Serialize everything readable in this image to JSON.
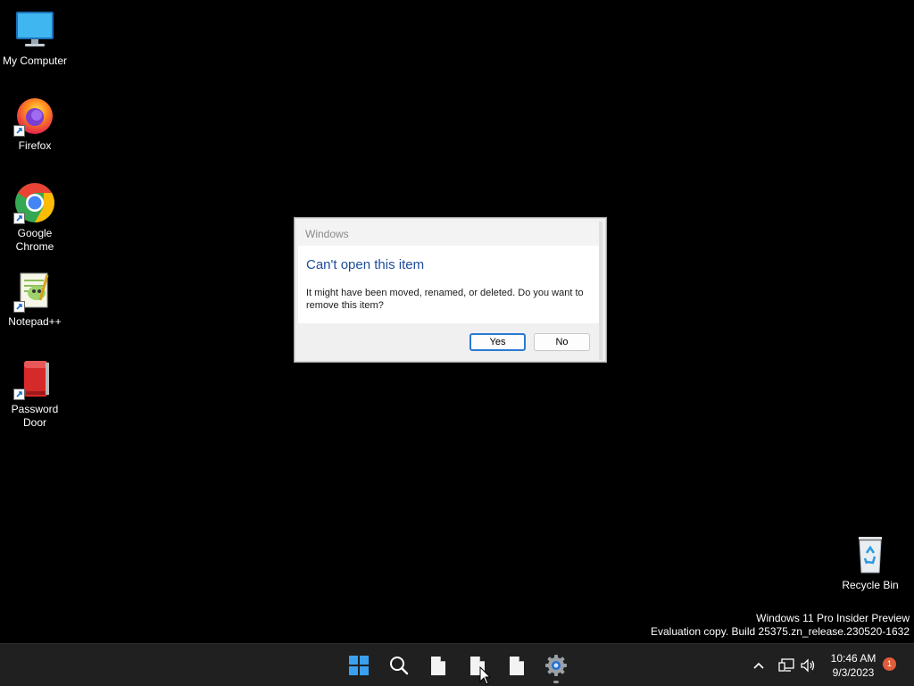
{
  "desktop": {
    "icons": [
      {
        "label": "My Computer",
        "icon": "monitor-icon"
      },
      {
        "label": "Firefox",
        "icon": "firefox-icon"
      },
      {
        "label": "Google Chrome",
        "icon": "chrome-icon"
      },
      {
        "label": "Notepad++",
        "icon": "notepad-plus-plus-icon"
      },
      {
        "label": "Password Door",
        "icon": "password-door-icon"
      },
      {
        "label": "Recycle Bin",
        "icon": "recycle-bin-icon"
      }
    ],
    "watermark": {
      "line1": "Windows 11 Pro Insider Preview",
      "line2": "Evaluation copy. Build 25375.zn_release.230520-1632"
    }
  },
  "dialog": {
    "title": "Windows",
    "heading": "Can't open this item",
    "message": "It might have been moved, renamed, or deleted. Do you want to remove this item?",
    "yes_label": "Yes",
    "no_label": "No",
    "heading_color": "#1e4d9b"
  },
  "taskbar": {
    "items": [
      "start-icon",
      "search-icon",
      "document-icon",
      "document-icon",
      "document-icon",
      "settings-icon"
    ],
    "tray": {
      "time": "10:46 AM",
      "date": "9/3/2023",
      "notification_count": "1"
    }
  },
  "colors": {
    "desktop_bg": "#000000",
    "taskbar_bg": "#202020",
    "accent": "#2a7ad3",
    "badge": "#e05c3b"
  }
}
